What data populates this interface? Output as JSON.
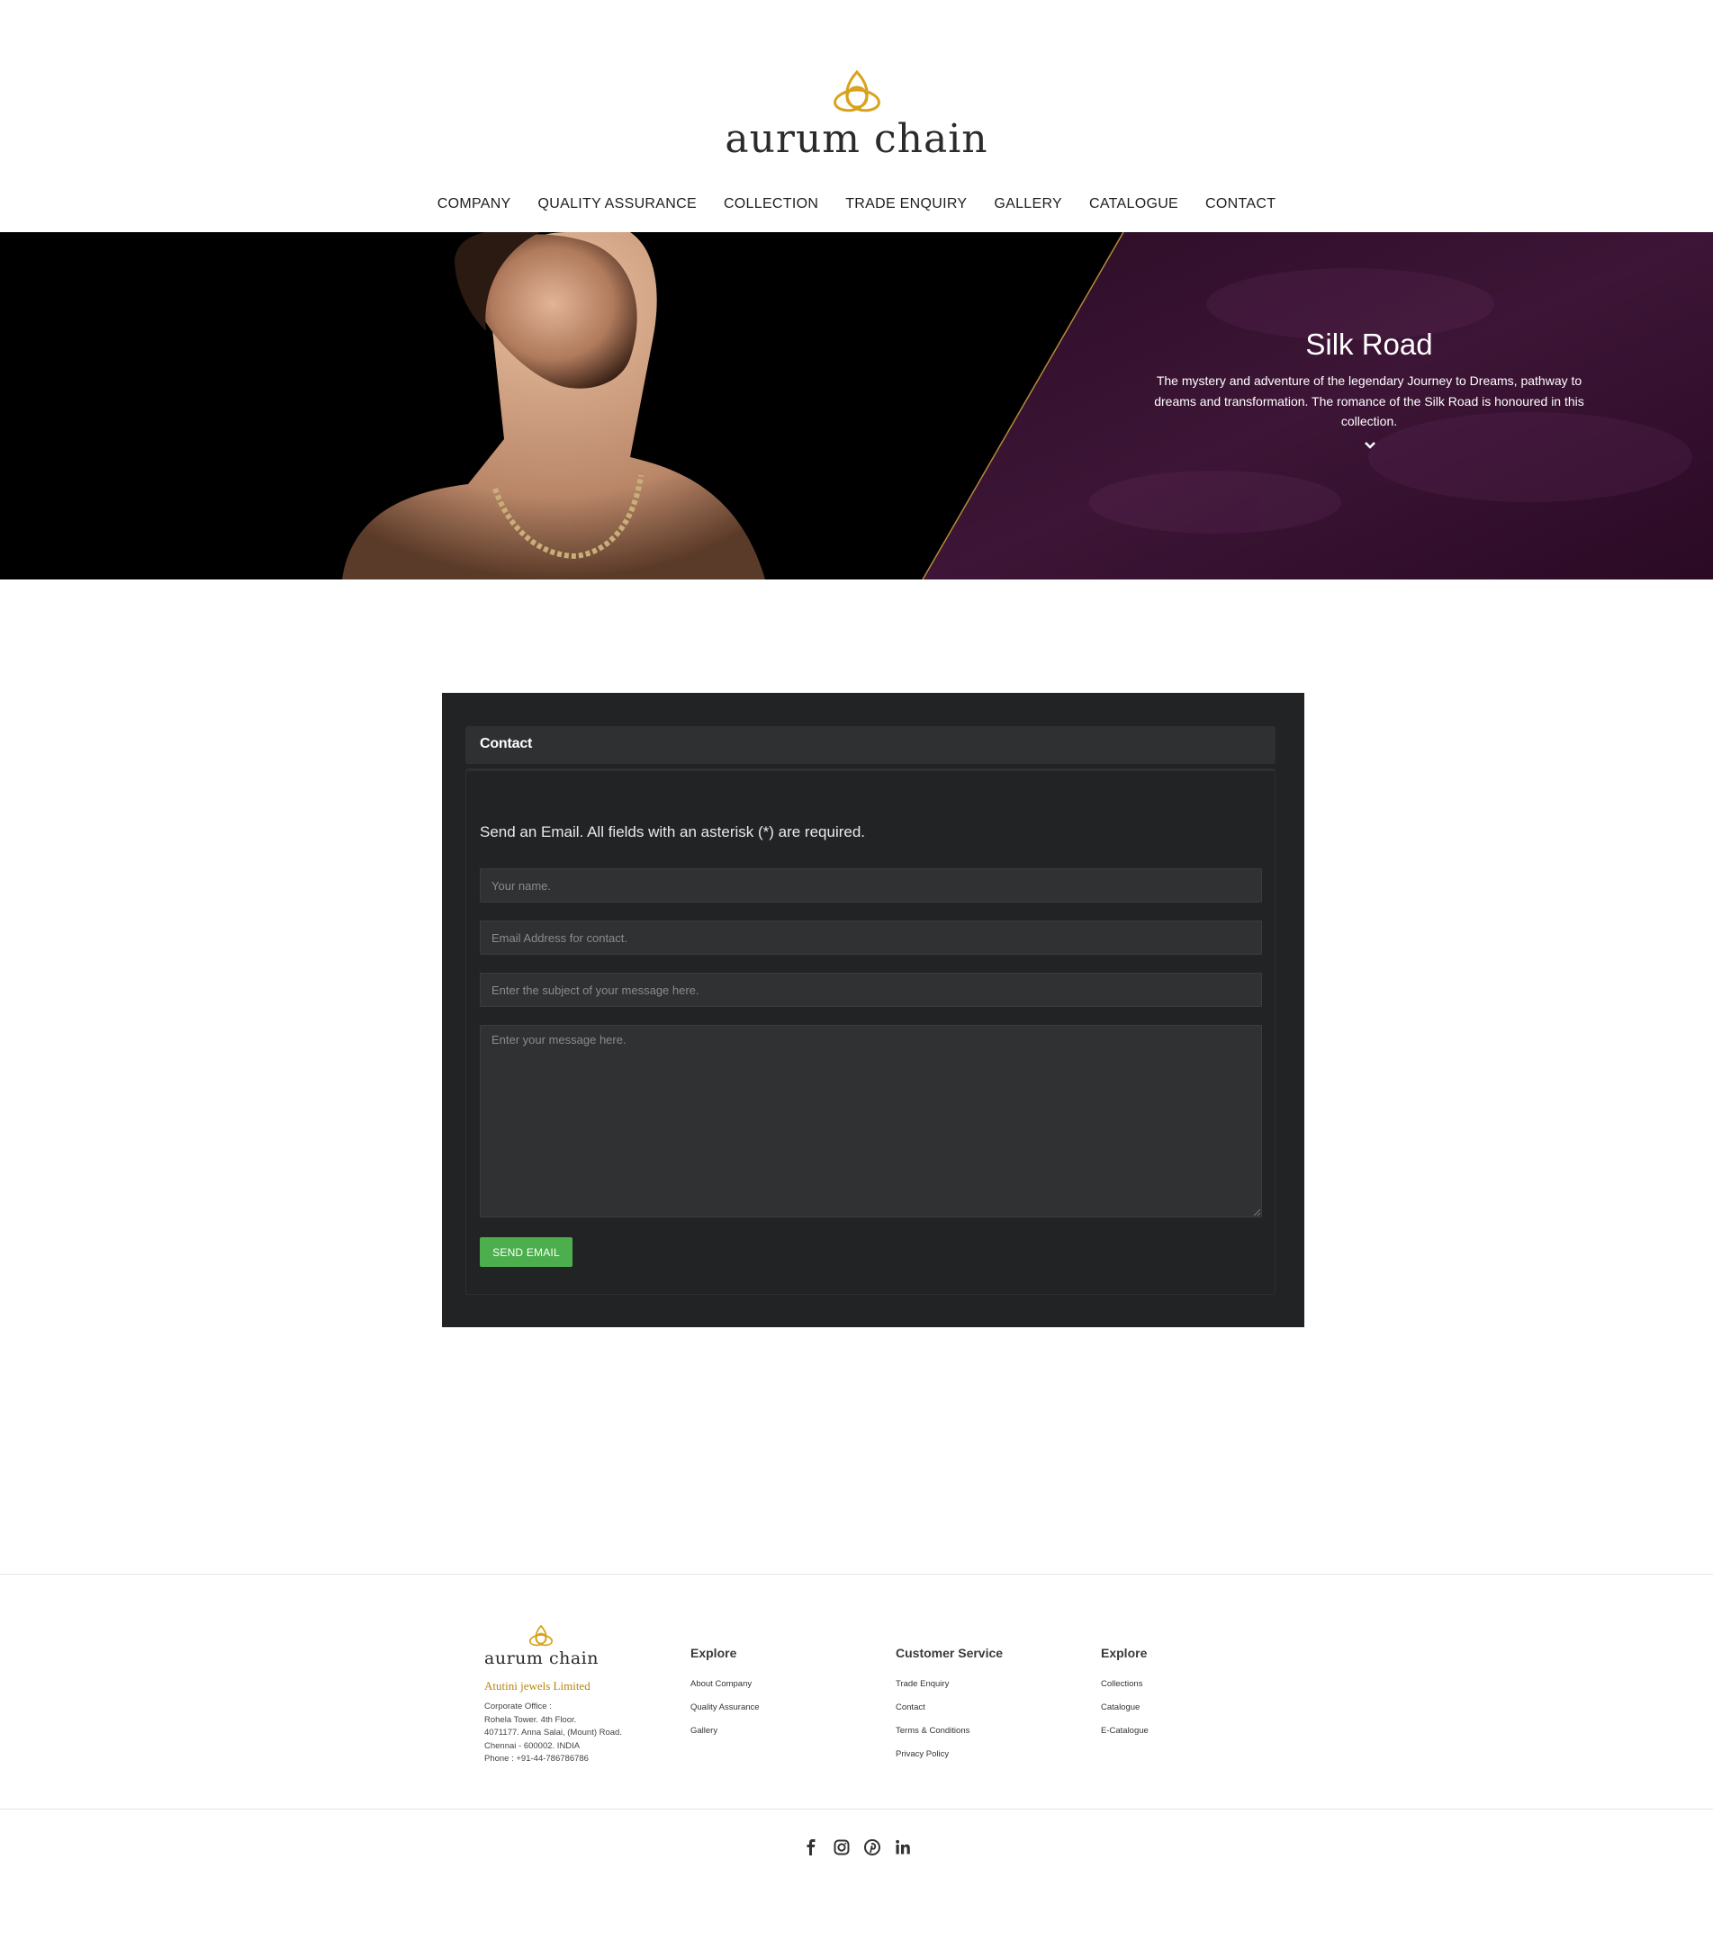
{
  "brand": {
    "name": "aurum chain",
    "logo_icon": "triquetra-icon",
    "accent_color": "#d9a21b"
  },
  "nav": {
    "items": [
      "COMPANY",
      "QUALITY ASSURANCE",
      "COLLECTION",
      "TRADE ENQUIRY",
      "GALLERY",
      "CATALOGUE",
      "CONTACT"
    ]
  },
  "hero": {
    "title": "Silk Road",
    "text": "The mystery and adventure of the legendary Journey to Dreams, pathway to dreams and transformation. The romance of the Silk Road is honoured in this collection.",
    "chevron_icon": "chevron-down-icon",
    "panel_color": "#3a1233"
  },
  "contact": {
    "header": "Contact",
    "intro": "Send an Email. All fields with an asterisk (*) are required.",
    "name_placeholder": "Your name.",
    "email_placeholder": "Email Address for contact.",
    "subject_placeholder": "Enter the subject of your message here.",
    "message_placeholder": "Enter your message here.",
    "send_label": "SEND EMAIL",
    "send_color": "#4cae4c"
  },
  "footer": {
    "brand_name": "aurum chain",
    "company": "Atutini jewels Limited",
    "address_lines": [
      "Corporate Office :",
      "Rohela Tower. 4th Floor.",
      "4071177. Anna Salai, (Mount) Road.",
      "Chennai - 600002. INDIA",
      "Phone : +91-44-786786786"
    ],
    "columns": [
      {
        "title": "Explore",
        "links": [
          "About Company",
          "Quality Assurance",
          "Gallery"
        ]
      },
      {
        "title": "Customer Service",
        "links": [
          "Trade Enquiry",
          "Contact",
          "Terms & Conditions",
          "Privacy Policy"
        ]
      },
      {
        "title": "Explore",
        "links": [
          "Collections",
          "Catalogue",
          "E-Catalogue"
        ]
      }
    ],
    "social_icons": [
      "facebook-icon",
      "instagram-icon",
      "pinterest-icon",
      "linkedin-icon"
    ]
  }
}
